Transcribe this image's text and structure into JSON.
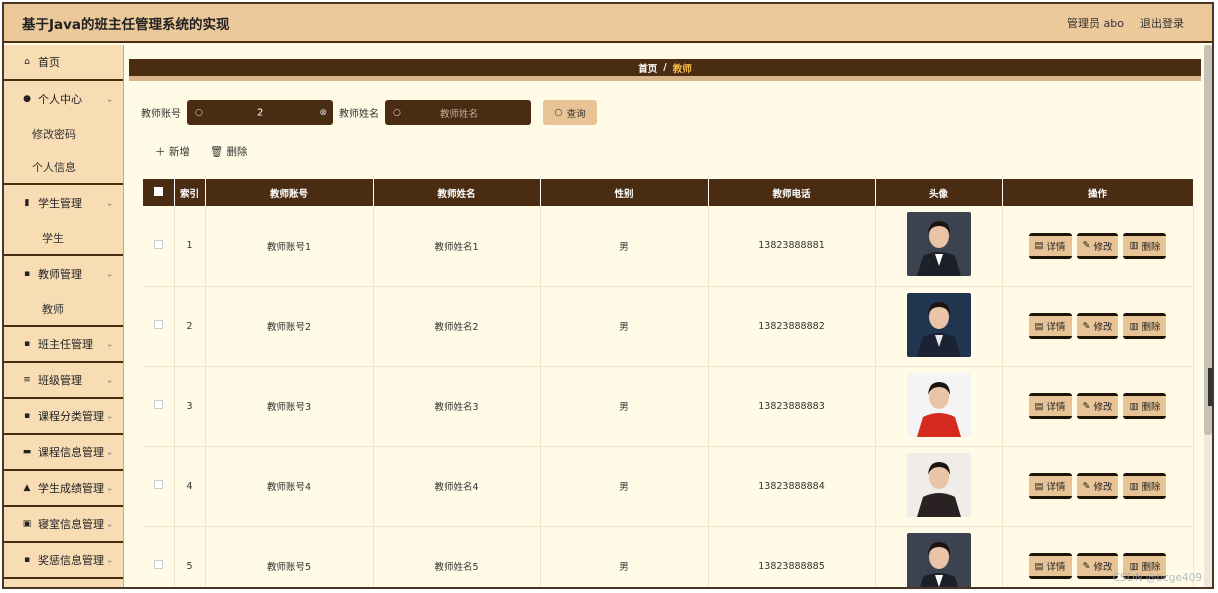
{
  "header": {
    "title": "基于Java的班主任管理系统的实现",
    "user_label": "管理员 abo",
    "logout_label": "退出登录"
  },
  "sidebar": {
    "items": [
      {
        "label": "首页",
        "icon": "home-icon",
        "glyph": "⌂"
      },
      {
        "label": "个人中心",
        "icon": "user-icon",
        "glyph": "●",
        "sub": [
          "修改密码",
          "个人信息"
        ]
      },
      {
        "label": "学生管理",
        "icon": "bar-chart-icon",
        "glyph": "▮",
        "sub": [
          "学生"
        ]
      },
      {
        "label": "教师管理",
        "icon": "grid-icon",
        "glyph": "▪",
        "sub": [
          "教师"
        ]
      },
      {
        "label": "班主任管理",
        "icon": "grid-icon",
        "glyph": "▪"
      },
      {
        "label": "班级管理",
        "icon": "list-icon",
        "glyph": "≡"
      },
      {
        "label": "课程分类管理",
        "icon": "grid-icon",
        "glyph": "▪"
      },
      {
        "label": "课程信息管理",
        "icon": "briefcase-icon",
        "glyph": "▬"
      },
      {
        "label": "学生成绩管理",
        "icon": "thumbs-up-icon",
        "glyph": "▲"
      },
      {
        "label": "寝室信息管理",
        "icon": "document-icon",
        "glyph": "▣"
      },
      {
        "label": "奖惩信息管理",
        "icon": "grid-icon",
        "glyph": "▪"
      },
      {
        "label": "",
        "icon": "grid-icon",
        "glyph": "▪"
      }
    ]
  },
  "breadcrumb": {
    "home": "首页",
    "separator": "/",
    "current": "教师"
  },
  "search": {
    "account_label": "教师账号",
    "account_value": "2",
    "name_label": "教师姓名",
    "name_placeholder": "教师姓名",
    "query_label": "查询"
  },
  "actions": {
    "add_label": "新增",
    "delete_label": "删除"
  },
  "table": {
    "headers": [
      "索引",
      "教师账号",
      "教师姓名",
      "性别",
      "教师电话",
      "头像",
      "操作"
    ],
    "rows": [
      {
        "index": "1",
        "account": "教师账号1",
        "name": "教师姓名1",
        "gender": "男",
        "phone": "13823888881"
      },
      {
        "index": "2",
        "account": "教师账号2",
        "name": "教师姓名2",
        "gender": "男",
        "phone": "13823888882"
      },
      {
        "index": "3",
        "account": "教师账号3",
        "name": "教师姓名3",
        "gender": "男",
        "phone": "13823888883"
      },
      {
        "index": "4",
        "account": "教师账号4",
        "name": "教师姓名4",
        "gender": "男",
        "phone": "13823888884"
      },
      {
        "index": "5",
        "account": "教师账号5",
        "name": "教师姓名5",
        "gender": "男",
        "phone": "13823888885"
      }
    ],
    "op_labels": {
      "detail": "详情",
      "edit": "修改",
      "delete": "删除"
    }
  },
  "watermark": "CSDN @bcge409"
}
